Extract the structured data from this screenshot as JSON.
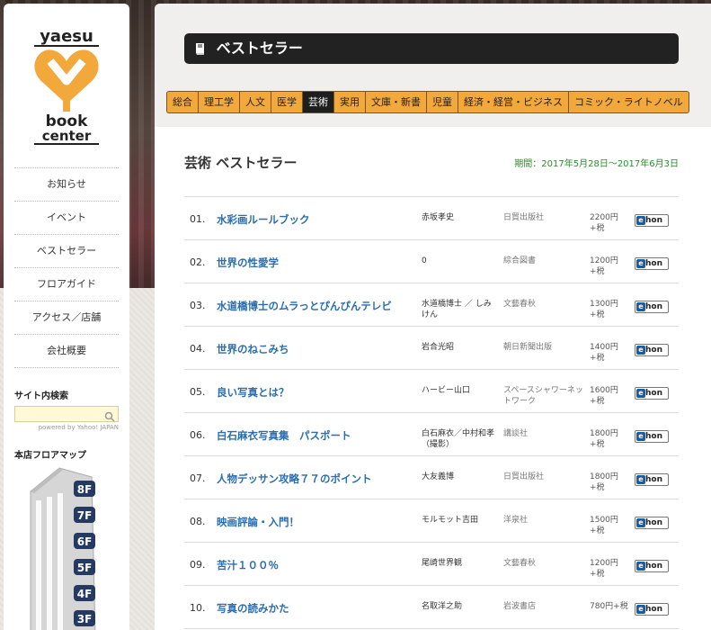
{
  "logo": {
    "line1": "yaesu",
    "line2": "book",
    "line3": "center",
    "accent": "#f2a83b"
  },
  "sidebar": {
    "nav": [
      {
        "label": "お知らせ"
      },
      {
        "label": "イベント"
      },
      {
        "label": "ベストセラー"
      },
      {
        "label": "フロアガイド"
      },
      {
        "label": "アクセス／店舗"
      },
      {
        "label": "会社概要"
      }
    ],
    "search_title": "サイト内検索",
    "search_placeholder": "",
    "powered_by": "powered by Yahoo! JAPAN",
    "floor_title": "本店フロアマップ",
    "floors": [
      "8F",
      "7F",
      "6F",
      "5F",
      "4F",
      "3F"
    ]
  },
  "main": {
    "banner": "ベストセラー",
    "tabs": [
      {
        "label": "総合"
      },
      {
        "label": "理工学"
      },
      {
        "label": "人文"
      },
      {
        "label": "医学"
      },
      {
        "label": "芸術",
        "active": true
      },
      {
        "label": "実用"
      },
      {
        "label": "文庫・新書"
      },
      {
        "label": "児童"
      },
      {
        "label": "経済・経営・ビジネス"
      },
      {
        "label": "コミック・ライトノベル"
      }
    ],
    "section_title": "芸術 ベストセラー",
    "period": "期間：2017年5月28日〜2017年6月3日",
    "books": [
      {
        "rank": "01.",
        "title": "水彩画ルールブック",
        "author": "赤坂孝史",
        "publisher": "日貿出版社",
        "price": "2200円+税"
      },
      {
        "rank": "02.",
        "title": "世界の性愛学",
        "author": "0",
        "publisher": "綜合図書",
        "price": "1200円+税"
      },
      {
        "rank": "03.",
        "title": "水道橋博士のムラっとぴんぴんテレビ",
        "author": "水道橋博士 ／ しみけん",
        "publisher": "文藝春秋",
        "price": "1300円+税"
      },
      {
        "rank": "04.",
        "title": "世界のねこみち",
        "author": "岩合光昭",
        "publisher": "朝日新聞出版",
        "price": "1400円+税"
      },
      {
        "rank": "05.",
        "title": "良い写真とは？",
        "author": "ハービー山口",
        "publisher": "スペースシャワーネットワーク",
        "price": "1600円+税"
      },
      {
        "rank": "06.",
        "title": "白石麻衣写真集　パスポート",
        "author": "白石麻衣／中村和孝（撮影）",
        "publisher": "講談社",
        "price": "1800円+税"
      },
      {
        "rank": "07.",
        "title": "人物デッサン攻略７７のポイント",
        "author": "大友義博",
        "publisher": "日貿出版社",
        "price": "1800円+税"
      },
      {
        "rank": "08.",
        "title": "映画評論・入門！",
        "author": "モルモット吉田",
        "publisher": "洋泉社",
        "price": "1500円+税"
      },
      {
        "rank": "09.",
        "title": "苦汁１００％",
        "author": "尾崎世界観",
        "publisher": "文藝春秋",
        "price": "1200円+税"
      },
      {
        "rank": "10.",
        "title": "写真の読みかた",
        "author": "名取洋之助",
        "publisher": "岩波書店",
        "price": "780円+税"
      }
    ],
    "ehon_label": "hon",
    "ehon_e": "e"
  }
}
